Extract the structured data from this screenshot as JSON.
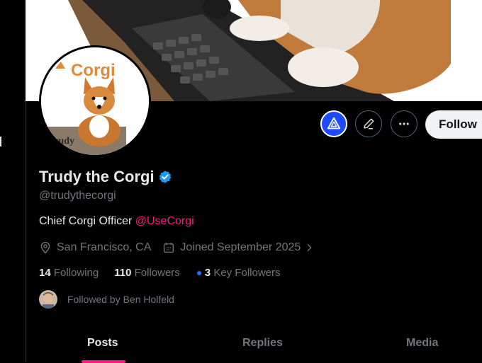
{
  "profile": {
    "display_name": "Trudy the Corgi",
    "handle": "@trudythecorgi",
    "bio_text": "Chief Corgi Officer ",
    "bio_mention": "@UseCorgi",
    "location": "San Francisco, CA",
    "joined": "Joined September 2025",
    "following_count": "14",
    "following_label": "Following",
    "followers_count": "110",
    "followers_label": "Followers",
    "key_followers_count": "3",
    "key_followers_label": "Key Followers",
    "followed_by": "Followed by Ben Holfeld"
  },
  "avatar_art": {
    "logo_text": "Corgi",
    "laptop_text": "Trudy"
  },
  "actions": {
    "follow_label": "Follow"
  },
  "tabs": [
    {
      "label": "Posts"
    },
    {
      "label": "Replies"
    },
    {
      "label": "Media"
    }
  ],
  "colors": {
    "background": "#000000",
    "text_primary": "#e7e9ea",
    "text_secondary": "#71767b",
    "mention": "#f91880",
    "verified": "#1d9bf0",
    "follow_button_bg": "#eff3f4",
    "grok_button": "#1d4aff",
    "key_dot": "#2a6bff"
  },
  "icons": [
    "grok-icon",
    "pencil-icon",
    "more-icon",
    "verified-badge-icon",
    "location-icon",
    "calendar-icon",
    "chevron-right-icon"
  ]
}
